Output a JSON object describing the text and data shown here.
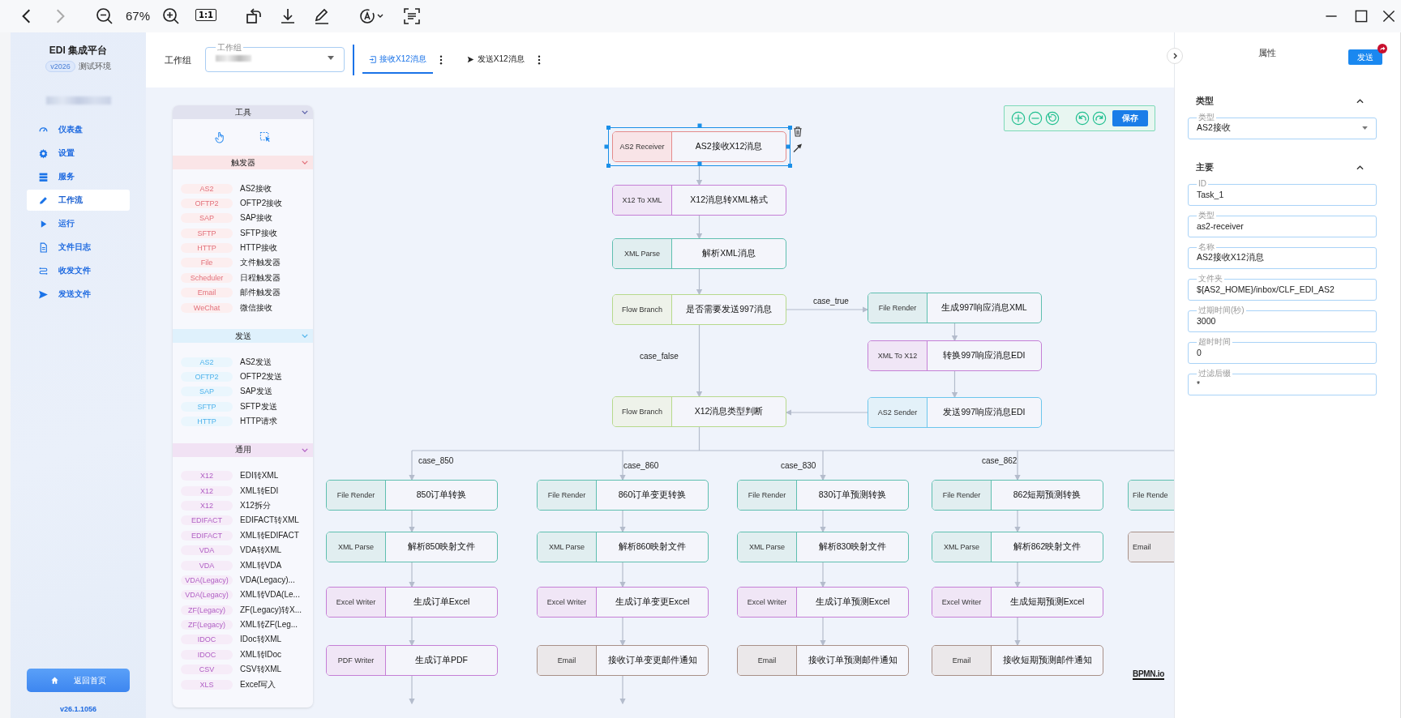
{
  "viewer_toolbar": {
    "zoom": "67%",
    "actual_size": "1:1"
  },
  "sidebar": {
    "title": "EDI 集成平台",
    "version_badge": "v2026",
    "environment": "测试环境",
    "nav": [
      {
        "label": "仪表盘",
        "selected": false
      },
      {
        "label": "设置",
        "selected": false
      },
      {
        "label": "服务",
        "selected": false
      },
      {
        "label": "工作流",
        "selected": true
      },
      {
        "label": "运行",
        "selected": false
      },
      {
        "label": "文件日志",
        "selected": false
      },
      {
        "label": "收发文件",
        "selected": false
      },
      {
        "label": "发送文件",
        "selected": false
      }
    ],
    "home_button": "返回首页",
    "version": "v26.1.1056"
  },
  "header": {
    "workgroup_label": "工作组",
    "workgroup_field_label": "工作组",
    "tabs": [
      {
        "label": "接收X12消息",
        "selected": true
      },
      {
        "label": "发送X12消息",
        "selected": false
      }
    ]
  },
  "palette": {
    "sections": [
      {
        "title": "工具",
        "kind": "tools",
        "color": "#5a5fa8"
      },
      {
        "title": "触发器",
        "kind": "items",
        "color": "#e2707a",
        "items": [
          {
            "tag": "AS2",
            "label": "AS2接收"
          },
          {
            "tag": "OFTP2",
            "label": "OFTP2接收"
          },
          {
            "tag": "SAP",
            "label": "SAP接收"
          },
          {
            "tag": "SFTP",
            "label": "SFTP接收"
          },
          {
            "tag": "HTTP",
            "label": "HTTP接收"
          },
          {
            "tag": "File",
            "label": "文件触发器"
          },
          {
            "tag": "Scheduler",
            "label": "日程触发器"
          },
          {
            "tag": "Email",
            "label": "邮件触发器"
          },
          {
            "tag": "WeChat",
            "label": "微信接收"
          }
        ]
      },
      {
        "title": "发送",
        "kind": "items",
        "color": "#4fb3ec",
        "items": [
          {
            "tag": "AS2",
            "label": "AS2发送"
          },
          {
            "tag": "OFTP2",
            "label": "OFTP2发送"
          },
          {
            "tag": "SAP",
            "label": "SAP发送"
          },
          {
            "tag": "SFTP",
            "label": "SFTP发送"
          },
          {
            "tag": "HTTP",
            "label": "HTTP请求"
          }
        ]
      },
      {
        "title": "通用",
        "kind": "items",
        "color": "#b05ec4",
        "items": [
          {
            "tag": "X12",
            "label": "EDI转XML"
          },
          {
            "tag": "X12",
            "label": "XML转EDI"
          },
          {
            "tag": "X12",
            "label": "X12拆分"
          },
          {
            "tag": "EDIFACT",
            "label": "EDIFACT转XML"
          },
          {
            "tag": "EDIFACT",
            "label": "XML转EDIFACT"
          },
          {
            "tag": "VDA",
            "label": "VDA转XML"
          },
          {
            "tag": "VDA",
            "label": "XML转VDA"
          },
          {
            "tag": "VDA(Legacy)",
            "label": "VDA(Legacy)..."
          },
          {
            "tag": "VDA(Legacy)",
            "label": "XML转VDA(Le..."
          },
          {
            "tag": "ZF(Legacy)",
            "label": "ZF(Legacy)转X..."
          },
          {
            "tag": "ZF(Legacy)",
            "label": "XML转ZF(Leg..."
          },
          {
            "tag": "IDOC",
            "label": "IDoc转XML"
          },
          {
            "tag": "IDOC",
            "label": "XML转IDoc"
          },
          {
            "tag": "CSV",
            "label": "CSV转XML"
          },
          {
            "tag": "XLS",
            "label": "Excel写入"
          }
        ]
      }
    ]
  },
  "canvas": {
    "save_button": "保存",
    "logo": "BPMN.io",
    "branch_labels": [
      "case_true",
      "case_false"
    ],
    "main": [
      {
        "type": "AS2 Receiver",
        "name": "AS2接收X12消息",
        "kind": "trigger",
        "selected": true
      },
      {
        "type": "X12 To XML",
        "name": "X12消息转XML格式",
        "kind": "convert",
        "selected": false
      },
      {
        "type": "XML Parse",
        "name": "解析XML消息",
        "kind": "parse",
        "selected": false
      },
      {
        "type": "Flow Branch",
        "name": "是否需要发送997消息",
        "kind": "branch",
        "selected": false
      },
      {
        "type": "Flow Branch",
        "name": "X12消息类型判断",
        "kind": "branch",
        "selected": false
      }
    ],
    "side": [
      {
        "type": "File Render",
        "name": "生成997响应消息XML",
        "kind": "parse"
      },
      {
        "type": "XML To X12",
        "name": "转换997响应消息EDI",
        "kind": "convert"
      },
      {
        "type": "AS2 Sender",
        "name": "发送997响应消息EDI",
        "kind": "sender"
      }
    ],
    "branches": [
      {
        "label": "case_850",
        "nodes": [
          {
            "type": "File Render",
            "name": "850订单转换",
            "kind": "parse"
          },
          {
            "type": "XML Parse",
            "name": "解析850映射文件",
            "kind": "parse"
          },
          {
            "type": "Excel Writer",
            "name": "生成订单Excel",
            "kind": "convert"
          },
          {
            "type": "PDF Writer",
            "name": "生成订单PDF",
            "kind": "convert"
          }
        ]
      },
      {
        "label": "case_860",
        "nodes": [
          {
            "type": "File Render",
            "name": "860订单变更转换",
            "kind": "parse"
          },
          {
            "type": "XML Parse",
            "name": "解析860映射文件",
            "kind": "parse"
          },
          {
            "type": "Excel Writer",
            "name": "生成订单变更Excel",
            "kind": "convert"
          },
          {
            "type": "Email",
            "name": "接收订单变更邮件通知",
            "kind": "email"
          }
        ]
      },
      {
        "label": "case_830",
        "nodes": [
          {
            "type": "File Render",
            "name": "830订单预测转换",
            "kind": "parse"
          },
          {
            "type": "XML Parse",
            "name": "解析830映射文件",
            "kind": "parse"
          },
          {
            "type": "Excel Writer",
            "name": "生成订单预测Excel",
            "kind": "convert"
          },
          {
            "type": "Email",
            "name": "接收订单预测邮件通知",
            "kind": "email"
          }
        ]
      },
      {
        "label": "case_862",
        "nodes": [
          {
            "type": "File Render",
            "name": "862短期预测转换",
            "kind": "parse"
          },
          {
            "type": "XML Parse",
            "name": "解析862映射文件",
            "kind": "parse"
          },
          {
            "type": "Excel Writer",
            "name": "生成短期预测Excel",
            "kind": "convert"
          },
          {
            "type": "Email",
            "name": "接收短期预测邮件通知",
            "kind": "email"
          }
        ]
      },
      {
        "nodes": [
          {
            "type": "File Rende",
            "kind": "parse"
          },
          {
            "type": "Email",
            "kind": "email"
          }
        ]
      }
    ]
  },
  "properties": {
    "title": "属性",
    "send_button": "发送",
    "sections": [
      {
        "title": "类型",
        "expanded": true,
        "fields": [
          {
            "label": "类型",
            "value": "AS2接收",
            "kind": "select"
          }
        ]
      },
      {
        "title": "主要",
        "expanded": true,
        "fields": [
          {
            "label": "ID",
            "value": "Task_1",
            "kind": "text"
          },
          {
            "label": "类型",
            "value": "as2-receiver",
            "kind": "text"
          },
          {
            "label": "名称",
            "value": "AS2接收X12消息",
            "kind": "text"
          },
          {
            "label": "文件夹",
            "value": "${AS2_HOME}/inbox/CLF_EDI_AS2",
            "kind": "text"
          },
          {
            "label": "过期时间(秒)",
            "value": "3000",
            "kind": "text"
          },
          {
            "label": "超时时间",
            "value": "0",
            "kind": "text"
          },
          {
            "label": "过滤后缀",
            "value": "*",
            "kind": "text"
          }
        ]
      }
    ]
  }
}
